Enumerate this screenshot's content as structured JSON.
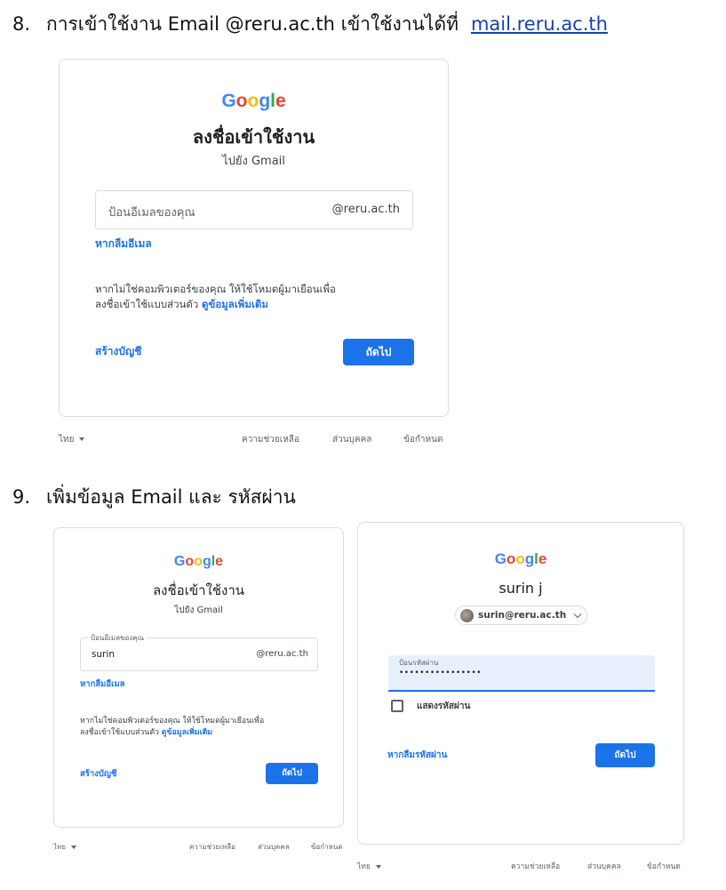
{
  "step8": {
    "number": "8.",
    "text": "การเข้าใช้งาน Email @reru.ac.th  เข้าใช้งานได้ที่",
    "link": "mail.reru.ac.th"
  },
  "step9": {
    "number": "9.",
    "text": "เพิ่มข้อมูล Email  และ รหัสผ่าน"
  },
  "logo_letters": [
    "G",
    "o",
    "o",
    "g",
    "l",
    "e"
  ],
  "colors": {
    "blue": "#4285f4",
    "red": "#ea4335",
    "yellow": "#fbbc05",
    "green": "#34a853",
    "accent": "#1a73e8"
  },
  "signin": {
    "title": "ลงชื่อเข้าใช้งาน",
    "subtitle": "ไปยัง Gmail",
    "email_placeholder": "ป้อนอีเมลของคุณ",
    "email_label": "ป้อนอีเมลของคุณ",
    "email_value": "surin",
    "domain_suffix": "@reru.ac.th",
    "forgot_email": "หากลืมอีเมล",
    "guest_note_line1": "หากไม่ใช่คอมพิวเตอร์ของคุณ ให้ใช้โหมดผู้มาเยือนเพื่อ",
    "guest_note_line2": "ลงชื่อเข้าใช้แบบส่วนตัว",
    "learn_more": "ดูข้อมูลเพิ่มเติม",
    "create_account": "สร้างบัญชี",
    "next": "ถัดไป"
  },
  "password_card": {
    "name": "surin j",
    "account_email": "surin@reru.ac.th",
    "password_label": "ป้อนรหัสผ่าน",
    "password_mask": "••••••••••••••••",
    "show_password": "แสดงรหัสผ่าน",
    "forgot_password": "หากลืมรหัสผ่าน",
    "next": "ถัดไป"
  },
  "footer": {
    "language": "ไทย",
    "help": "ความช่วยเหลือ",
    "privacy": "ส่วนบุคคล",
    "terms": "ข้อกำหนด"
  }
}
